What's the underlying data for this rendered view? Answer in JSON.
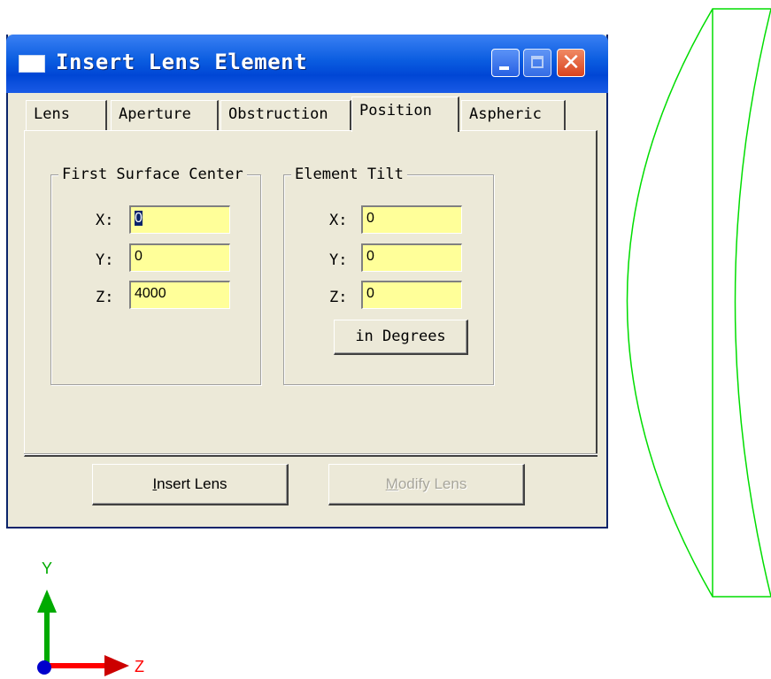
{
  "dialog": {
    "title": "Insert Lens Element",
    "tabs": [
      "Lens",
      "Aperture",
      "Obstruction",
      "Position",
      "Aspheric"
    ],
    "active_tab": "Position",
    "first_surface_center": {
      "title": "First Surface Center",
      "x_label": "X:",
      "x_value": "0",
      "y_label": "Y:",
      "y_value": "0",
      "z_label": "Z:",
      "z_value": "4000"
    },
    "element_tilt": {
      "title": "Element Tilt",
      "x_label": "X:",
      "x_value": "0",
      "y_label": "Y:",
      "y_value": "0",
      "z_label": "Z:",
      "z_value": "0",
      "degrees_button": "in Degrees"
    },
    "insert_button_prefix": "I",
    "insert_button_rest": "nsert Lens",
    "modify_button_prefix": "M",
    "modify_button_rest": "odify Lens"
  },
  "axes": {
    "vertical_label": "Y",
    "horizontal_label": "Z"
  },
  "colors": {
    "lens_outline": "#00dd00",
    "field_bg": "#ffff99",
    "axis_y": "#00aa00",
    "axis_z": "#ff0000",
    "axis_origin": "#0000cc"
  }
}
